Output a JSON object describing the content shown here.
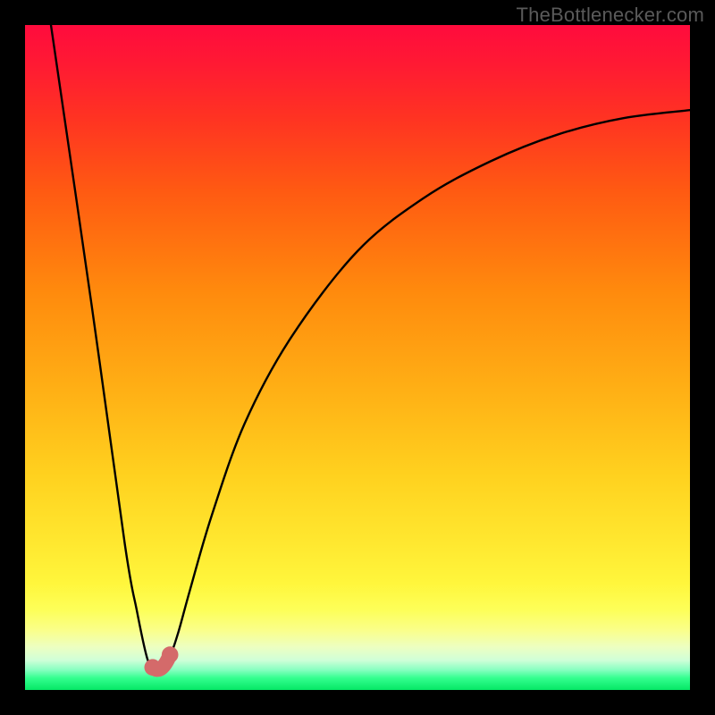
{
  "watermark": {
    "text": "TheBottlenecker.com"
  },
  "gradient": {
    "stops": [
      {
        "pos": 0,
        "color": "#ff0b3d"
      },
      {
        "pos": 0.06,
        "color": "#ff1a33"
      },
      {
        "pos": 0.14,
        "color": "#ff3322"
      },
      {
        "pos": 0.25,
        "color": "#ff5a12"
      },
      {
        "pos": 0.4,
        "color": "#ff8a0d"
      },
      {
        "pos": 0.55,
        "color": "#ffb015"
      },
      {
        "pos": 0.68,
        "color": "#ffd21f"
      },
      {
        "pos": 0.78,
        "color": "#ffe830"
      },
      {
        "pos": 0.84,
        "color": "#fff63c"
      },
      {
        "pos": 0.88,
        "color": "#fdff59"
      },
      {
        "pos": 0.91,
        "color": "#faff8a"
      },
      {
        "pos": 0.935,
        "color": "#edffc0"
      },
      {
        "pos": 0.955,
        "color": "#d0ffd8"
      },
      {
        "pos": 0.97,
        "color": "#86ffc0"
      },
      {
        "pos": 0.982,
        "color": "#34ff8f"
      },
      {
        "pos": 1.0,
        "color": "#05e765"
      }
    ]
  },
  "chart_data": {
    "type": "line",
    "title": "",
    "xlabel": "",
    "ylabel": "",
    "xlim": [
      0,
      100
    ],
    "ylim": [
      0,
      100
    ],
    "series": [
      {
        "name": "bottleneck-curve",
        "x": [
          3.9,
          10,
          15,
          16.8,
          18.3,
          19.2,
          20.0,
          21.8,
          23.0,
          24.8,
          28,
          33,
          40,
          50,
          60,
          70,
          80,
          90,
          100
        ],
        "y": [
          100,
          58,
          22,
          12,
          5,
          3.4,
          3.4,
          5.3,
          8.5,
          15,
          26,
          40,
          53,
          66,
          74,
          79.5,
          83.5,
          86,
          87.2
        ]
      }
    ],
    "markers": [
      {
        "name": "notch-left",
        "x": 19.2,
        "y": 3.4,
        "color": "#d46a6a",
        "r_percent": 1.25
      },
      {
        "name": "notch-right",
        "x": 21.8,
        "y": 5.3,
        "color": "#d46a6a",
        "r_percent": 1.25
      }
    ],
    "notch_connector": {
      "from": {
        "x": 19.2,
        "y": 3.4
      },
      "to": {
        "x": 21.8,
        "y": 5.3
      },
      "via": {
        "x": 20.5,
        "y": 2.2
      },
      "color": "#d46a6a",
      "stroke_percent": 2.2
    }
  }
}
